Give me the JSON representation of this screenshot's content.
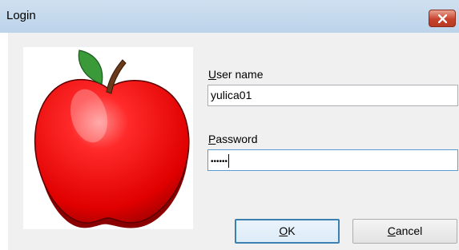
{
  "window": {
    "title": "Login"
  },
  "form": {
    "username_label_key": "U",
    "username_label_rest": "ser name",
    "username_value": "yulica01",
    "password_label_key": "P",
    "password_label_rest": "assword",
    "password_value": "••••••"
  },
  "buttons": {
    "ok_key": "O",
    "ok_rest": "K",
    "cancel_key": "C",
    "cancel_rest": "ancel"
  },
  "icons": {
    "close": "close-icon",
    "apple": "apple-icon"
  },
  "colors": {
    "titlebar": "#c4d8ee",
    "close": "#c7432d",
    "apple": "#e8141c",
    "leaf": "#3a9a3a"
  }
}
